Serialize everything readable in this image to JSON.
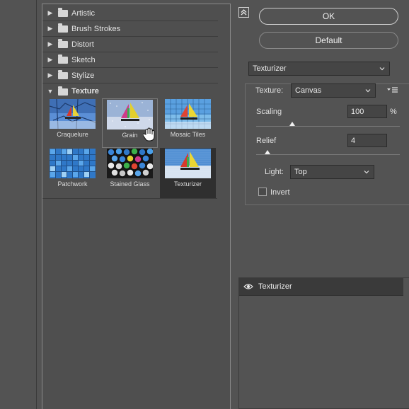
{
  "gallery": {
    "categories": [
      {
        "label": "Artistic",
        "expanded": false
      },
      {
        "label": "Brush Strokes",
        "expanded": false
      },
      {
        "label": "Distort",
        "expanded": false
      },
      {
        "label": "Sketch",
        "expanded": false
      },
      {
        "label": "Stylize",
        "expanded": false
      },
      {
        "label": "Texture",
        "expanded": true
      }
    ],
    "thumbnails": [
      {
        "label": "Craquelure",
        "style": "craquelure"
      },
      {
        "label": "Grain",
        "style": "grain",
        "hover": true
      },
      {
        "label": "Mosaic Tiles",
        "style": "mosaic"
      },
      {
        "label": "Patchwork",
        "style": "patchwork"
      },
      {
        "label": "Stained Glass",
        "style": "stained"
      },
      {
        "label": "Texturizer",
        "style": "texturizer",
        "selected": true
      }
    ]
  },
  "buttons": {
    "ok": "OK",
    "default": "Default"
  },
  "filter_select": {
    "value": "Texturizer"
  },
  "settings": {
    "texture_label": "Texture:",
    "texture_value": "Canvas",
    "scaling_label": "Scaling",
    "scaling_value": "100",
    "scaling_unit": "%",
    "scaling_percent": 25,
    "relief_label": "Relief",
    "relief_value": "4",
    "relief_percent": 8,
    "light_label": "Light:",
    "light_value": "Top",
    "invert_label": "Invert",
    "invert_checked": false
  },
  "layers": {
    "items": [
      {
        "name": "Texturizer",
        "visible": true
      }
    ]
  },
  "colors": {
    "panel_bg": "#535353",
    "field_bg": "#454545",
    "selected_bg": "#2f2f2f"
  }
}
